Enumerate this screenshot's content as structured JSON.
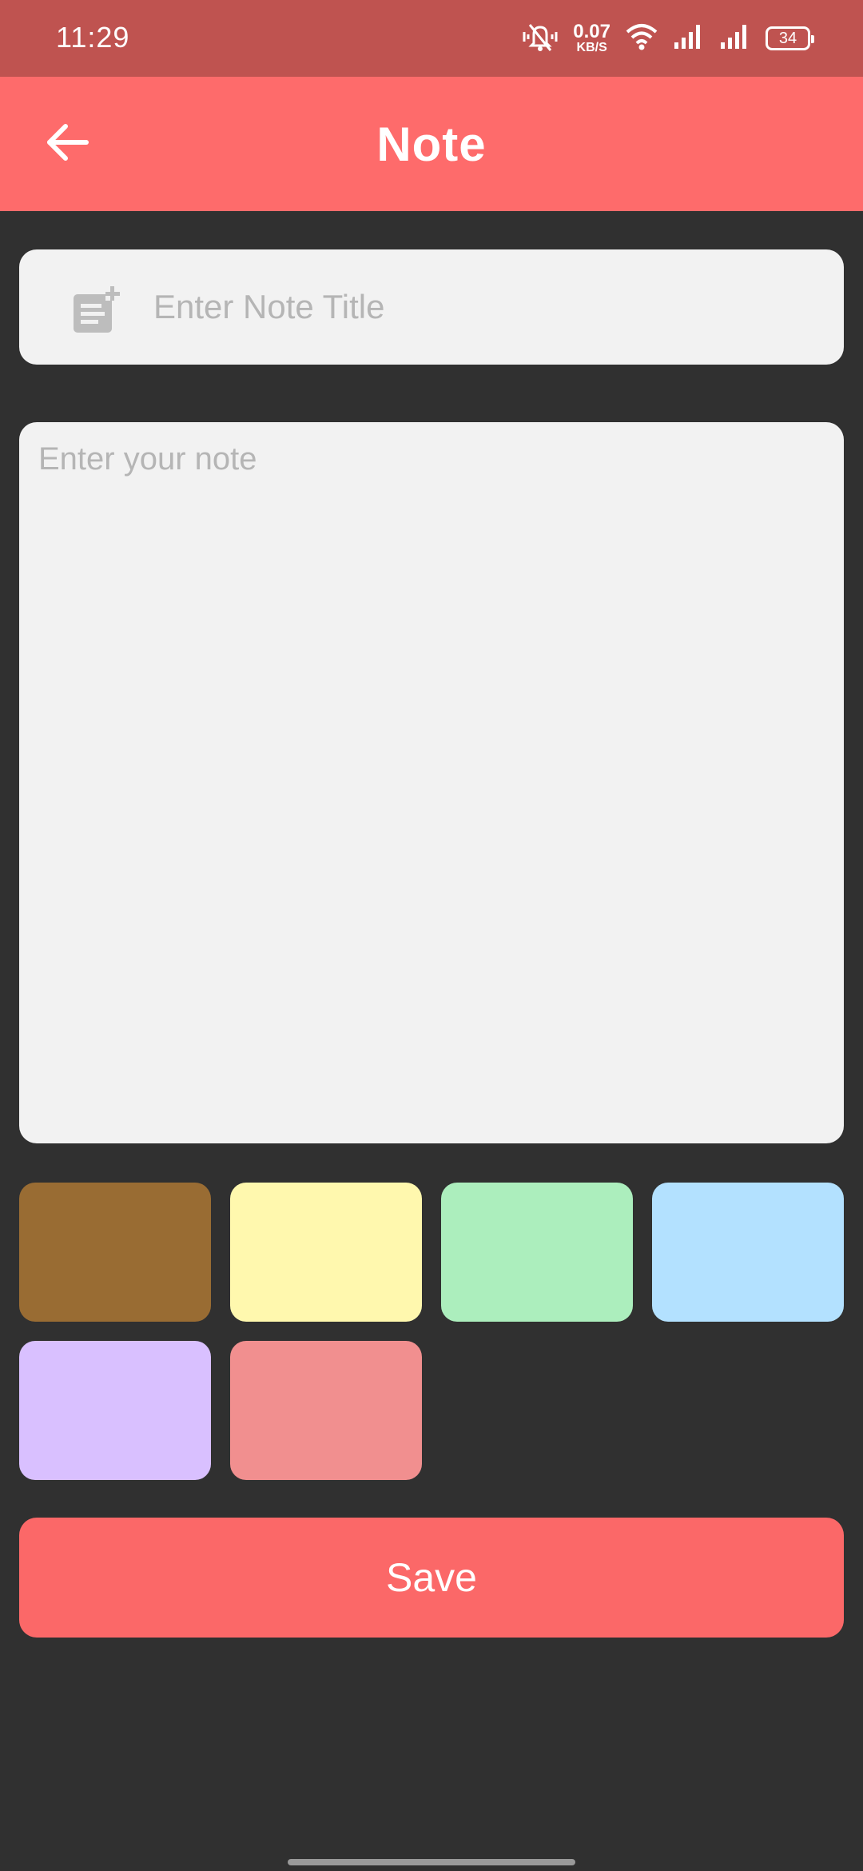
{
  "status_bar": {
    "time": "11:29",
    "net_speed_value": "0.07",
    "net_speed_unit": "KB/S",
    "battery": "34",
    "icons": [
      "vibrate-icon",
      "wifi-icon",
      "signal-icon",
      "signal-icon",
      "battery-icon"
    ]
  },
  "app_bar": {
    "title": "Note",
    "back_icon": "arrow-left-icon"
  },
  "title_field": {
    "placeholder": "Enter Note Title",
    "value": "",
    "icon": "note-add-icon"
  },
  "note_field": {
    "placeholder": "Enter your note",
    "value": ""
  },
  "colors": {
    "status_bar": "#bf5350",
    "app_bar": "#fe6b6b",
    "background": "#303030",
    "field": "#f2f2f2",
    "save_button": "#fb6868"
  },
  "swatches": [
    {
      "name": "brown",
      "color": "#996c33"
    },
    {
      "name": "yellow",
      "color": "#fff8ae"
    },
    {
      "name": "green",
      "color": "#aceebd"
    },
    {
      "name": "blue",
      "color": "#b3e1ff"
    },
    {
      "name": "purple",
      "color": "#d9c0ff"
    },
    {
      "name": "pink",
      "color": "#f18f8f"
    }
  ],
  "save_button": {
    "label": "Save"
  }
}
